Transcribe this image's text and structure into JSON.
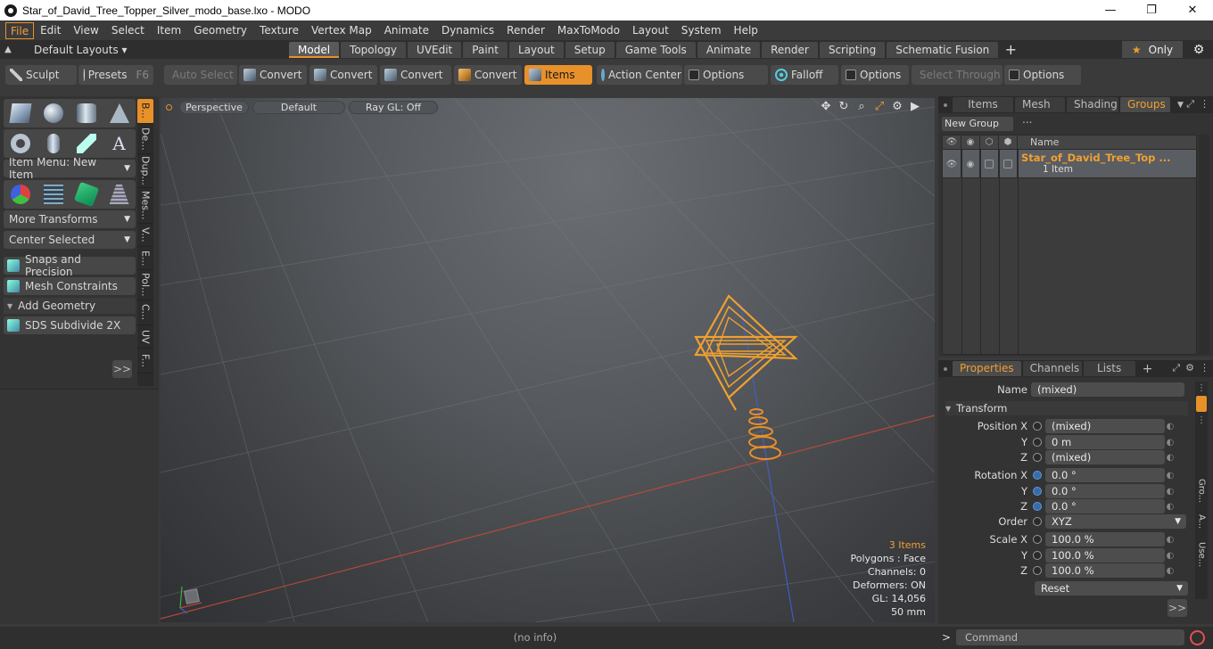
{
  "window": {
    "title": "Star_of_David_Tree_Topper_Silver_modo_base.lxo - MODO",
    "min": "—",
    "max": "❐",
    "close": "✕"
  },
  "menubar": [
    "File",
    "Edit",
    "View",
    "Select",
    "Item",
    "Geometry",
    "Texture",
    "Vertex Map",
    "Animate",
    "Dynamics",
    "Render",
    "MaxToModo",
    "Layout",
    "System",
    "Help"
  ],
  "layoutbar": {
    "layouts_label": "Default Layouts ▾",
    "tabs": [
      "Model",
      "Topology",
      "UVEdit",
      "Paint",
      "Layout",
      "Setup",
      "Game Tools",
      "Animate",
      "Render",
      "Scripting",
      "Schematic Fusion"
    ],
    "active_tab": "Model",
    "plus": "+",
    "only_label": "Only",
    "star": "★"
  },
  "toolbar": {
    "sculpt": "Sculpt",
    "presets": "Presets",
    "presets_key": "F6",
    "auto_select": "Auto Select",
    "convert": "Convert",
    "items": "Items",
    "action_center": "Action Center",
    "options": "Options",
    "falloff": "Falloff",
    "select_through": "Select Through"
  },
  "leftpanel": {
    "item_menu": "Item Menu: New Item",
    "more_transforms": "More Transforms",
    "center_selected": "Center Selected",
    "snaps": "Snaps and Precision",
    "mesh_constraints": "Mesh Constraints",
    "add_geometry": "Add Geometry",
    "sds_subdivide": "SDS Subdivide 2X",
    "more": ">>",
    "sidetabs": [
      "B...",
      "De...",
      "Dup...",
      "Mes...",
      "V...",
      "E...",
      "Pol...",
      "C...",
      "UV",
      "F..."
    ]
  },
  "viewport": {
    "perspective": "Perspective",
    "default": "Default",
    "raygl": "Ray GL: Off",
    "stats": {
      "items": "3 Items",
      "polygons": "Polygons : Face",
      "channels": "Channels: 0",
      "deformers": "Deformers: ON",
      "gl": "GL: 14,056",
      "size": "50 mm"
    }
  },
  "groups_panel": {
    "tabs": [
      "Items",
      "Mesh ...",
      "Shading",
      "Groups"
    ],
    "active_tab": "Groups",
    "new_group": "New Group",
    "col_name": "Name",
    "row_title": "Star_of_David_Tree_Top ...",
    "row_sub": "1 Item"
  },
  "properties_panel": {
    "tabs": [
      "Properties",
      "Channels",
      "Lists"
    ],
    "active_tab": "Properties",
    "name_label": "Name",
    "name_value": "(mixed)",
    "transform_label": "Transform",
    "position_x_label": "Position X",
    "position_x": "(mixed)",
    "position_y_label": "Y",
    "position_y": "0 m",
    "position_z_label": "Z",
    "position_z": "(mixed)",
    "rotation_x_label": "Rotation X",
    "rotation_x": "0.0 °",
    "rotation_y_label": "Y",
    "rotation_y": "0.0 °",
    "rotation_z_label": "Z",
    "rotation_z": "0.0 °",
    "order_label": "Order",
    "order_value": "XYZ",
    "scale_x_label": "Scale X",
    "scale_x": "100.0 %",
    "scale_y_label": "Y",
    "scale_y": "100.0 %",
    "scale_z_label": "Z",
    "scale_z": "100.0 %",
    "reset": "Reset",
    "more": ">>",
    "side_tabs": [
      "Gro...",
      "A...",
      "Use..."
    ]
  },
  "statusbar": {
    "info": "(no info)",
    "prompt": ">",
    "command_placeholder": "Command"
  },
  "colors": {
    "accent": "#e8902a",
    "model": "#f0a030"
  }
}
